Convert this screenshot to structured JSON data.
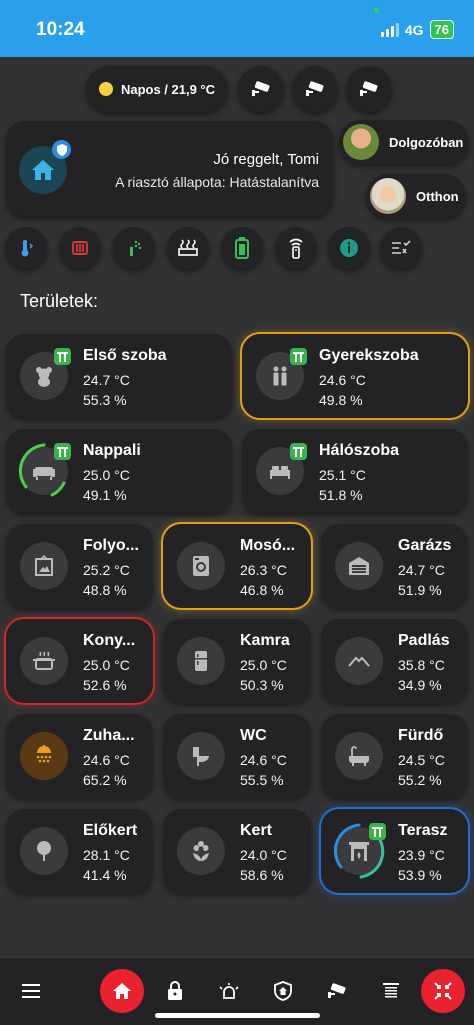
{
  "status_bar": {
    "time": "10:24",
    "network": "4G",
    "battery": "76"
  },
  "header": {
    "weather": "Napos / 21,9 °C",
    "camera_buttons": [
      "camera-1",
      "camera-2",
      "camera-3"
    ]
  },
  "greeting": {
    "title": "Jó reggelt, Tomi",
    "subtitle": "A riasztó állapota: Hatástalanítva"
  },
  "people": [
    {
      "status": "Dolgozóban"
    },
    {
      "status": "Otthon"
    }
  ],
  "quick_actions": [
    "temperature-icon",
    "heater-icon",
    "sprinkler-icon",
    "radiator-icon",
    "battery-icon",
    "remote-icon",
    "info-icon",
    "checklist-icon"
  ],
  "section_title": "Területek:",
  "rooms": [
    {
      "name": "Első szoba",
      "temp": "24.7 °C",
      "hum": "55.3 %",
      "icon": "teddy-bear-icon"
    },
    {
      "name": "Gyerekszoba",
      "temp": "24.6 °C",
      "hum": "49.8 %",
      "icon": "kids-icon"
    },
    {
      "name": "Nappali",
      "temp": "25.0 °C",
      "hum": "49.1 %",
      "icon": "sofa-icon"
    },
    {
      "name": "Hálószoba",
      "temp": "25.1 °C",
      "hum": "51.8 %",
      "icon": "bed-icon"
    },
    {
      "name": "Folyo...",
      "temp": "25.2 °C",
      "hum": "48.8 %",
      "icon": "picture-frame-icon"
    },
    {
      "name": "Mosó...",
      "temp": "26.3 °C",
      "hum": "46.8 %",
      "icon": "washing-machine-icon"
    },
    {
      "name": "Garázs",
      "temp": "24.7 °C",
      "hum": "51.9 %",
      "icon": "garage-icon"
    },
    {
      "name": "Kony...",
      "temp": "25.0 °C",
      "hum": "52.6 %",
      "icon": "pot-icon"
    },
    {
      "name": "Kamra",
      "temp": "25.0 °C",
      "hum": "50.3 %",
      "icon": "fridge-icon"
    },
    {
      "name": "Padlás",
      "temp": "35.8 °C",
      "hum": "34.9 %",
      "icon": "roof-icon"
    },
    {
      "name": "Zuha...",
      "temp": "24.6 °C",
      "hum": "65.2 %",
      "icon": "shower-icon"
    },
    {
      "name": "WC",
      "temp": "24.6 °C",
      "hum": "55.5 %",
      "icon": "toilet-icon"
    },
    {
      "name": "Fürdő",
      "temp": "24.5 °C",
      "hum": "55.2 %",
      "icon": "bathtub-icon"
    },
    {
      "name": "Előkert",
      "temp": "28.1 °C",
      "hum": "41.4 %",
      "icon": "tree-icon"
    },
    {
      "name": "Kert",
      "temp": "24.0 °C",
      "hum": "58.6 %",
      "icon": "flower-icon"
    },
    {
      "name": "Terasz",
      "temp": "23.9 °C",
      "hum": "53.9 %",
      "icon": "fireplace-icon"
    }
  ],
  "bottom_nav": [
    "menu-icon",
    "home-icon",
    "lock-icon",
    "alarm-icon",
    "shield-home-icon",
    "cctv-icon",
    "blinds-icon",
    "alert-icon"
  ],
  "colors": {
    "accent_blue": "#2aa0ea",
    "badge_green": "#39b44b",
    "alert_red": "#ea2230",
    "glow_orange": "#e0a012"
  }
}
